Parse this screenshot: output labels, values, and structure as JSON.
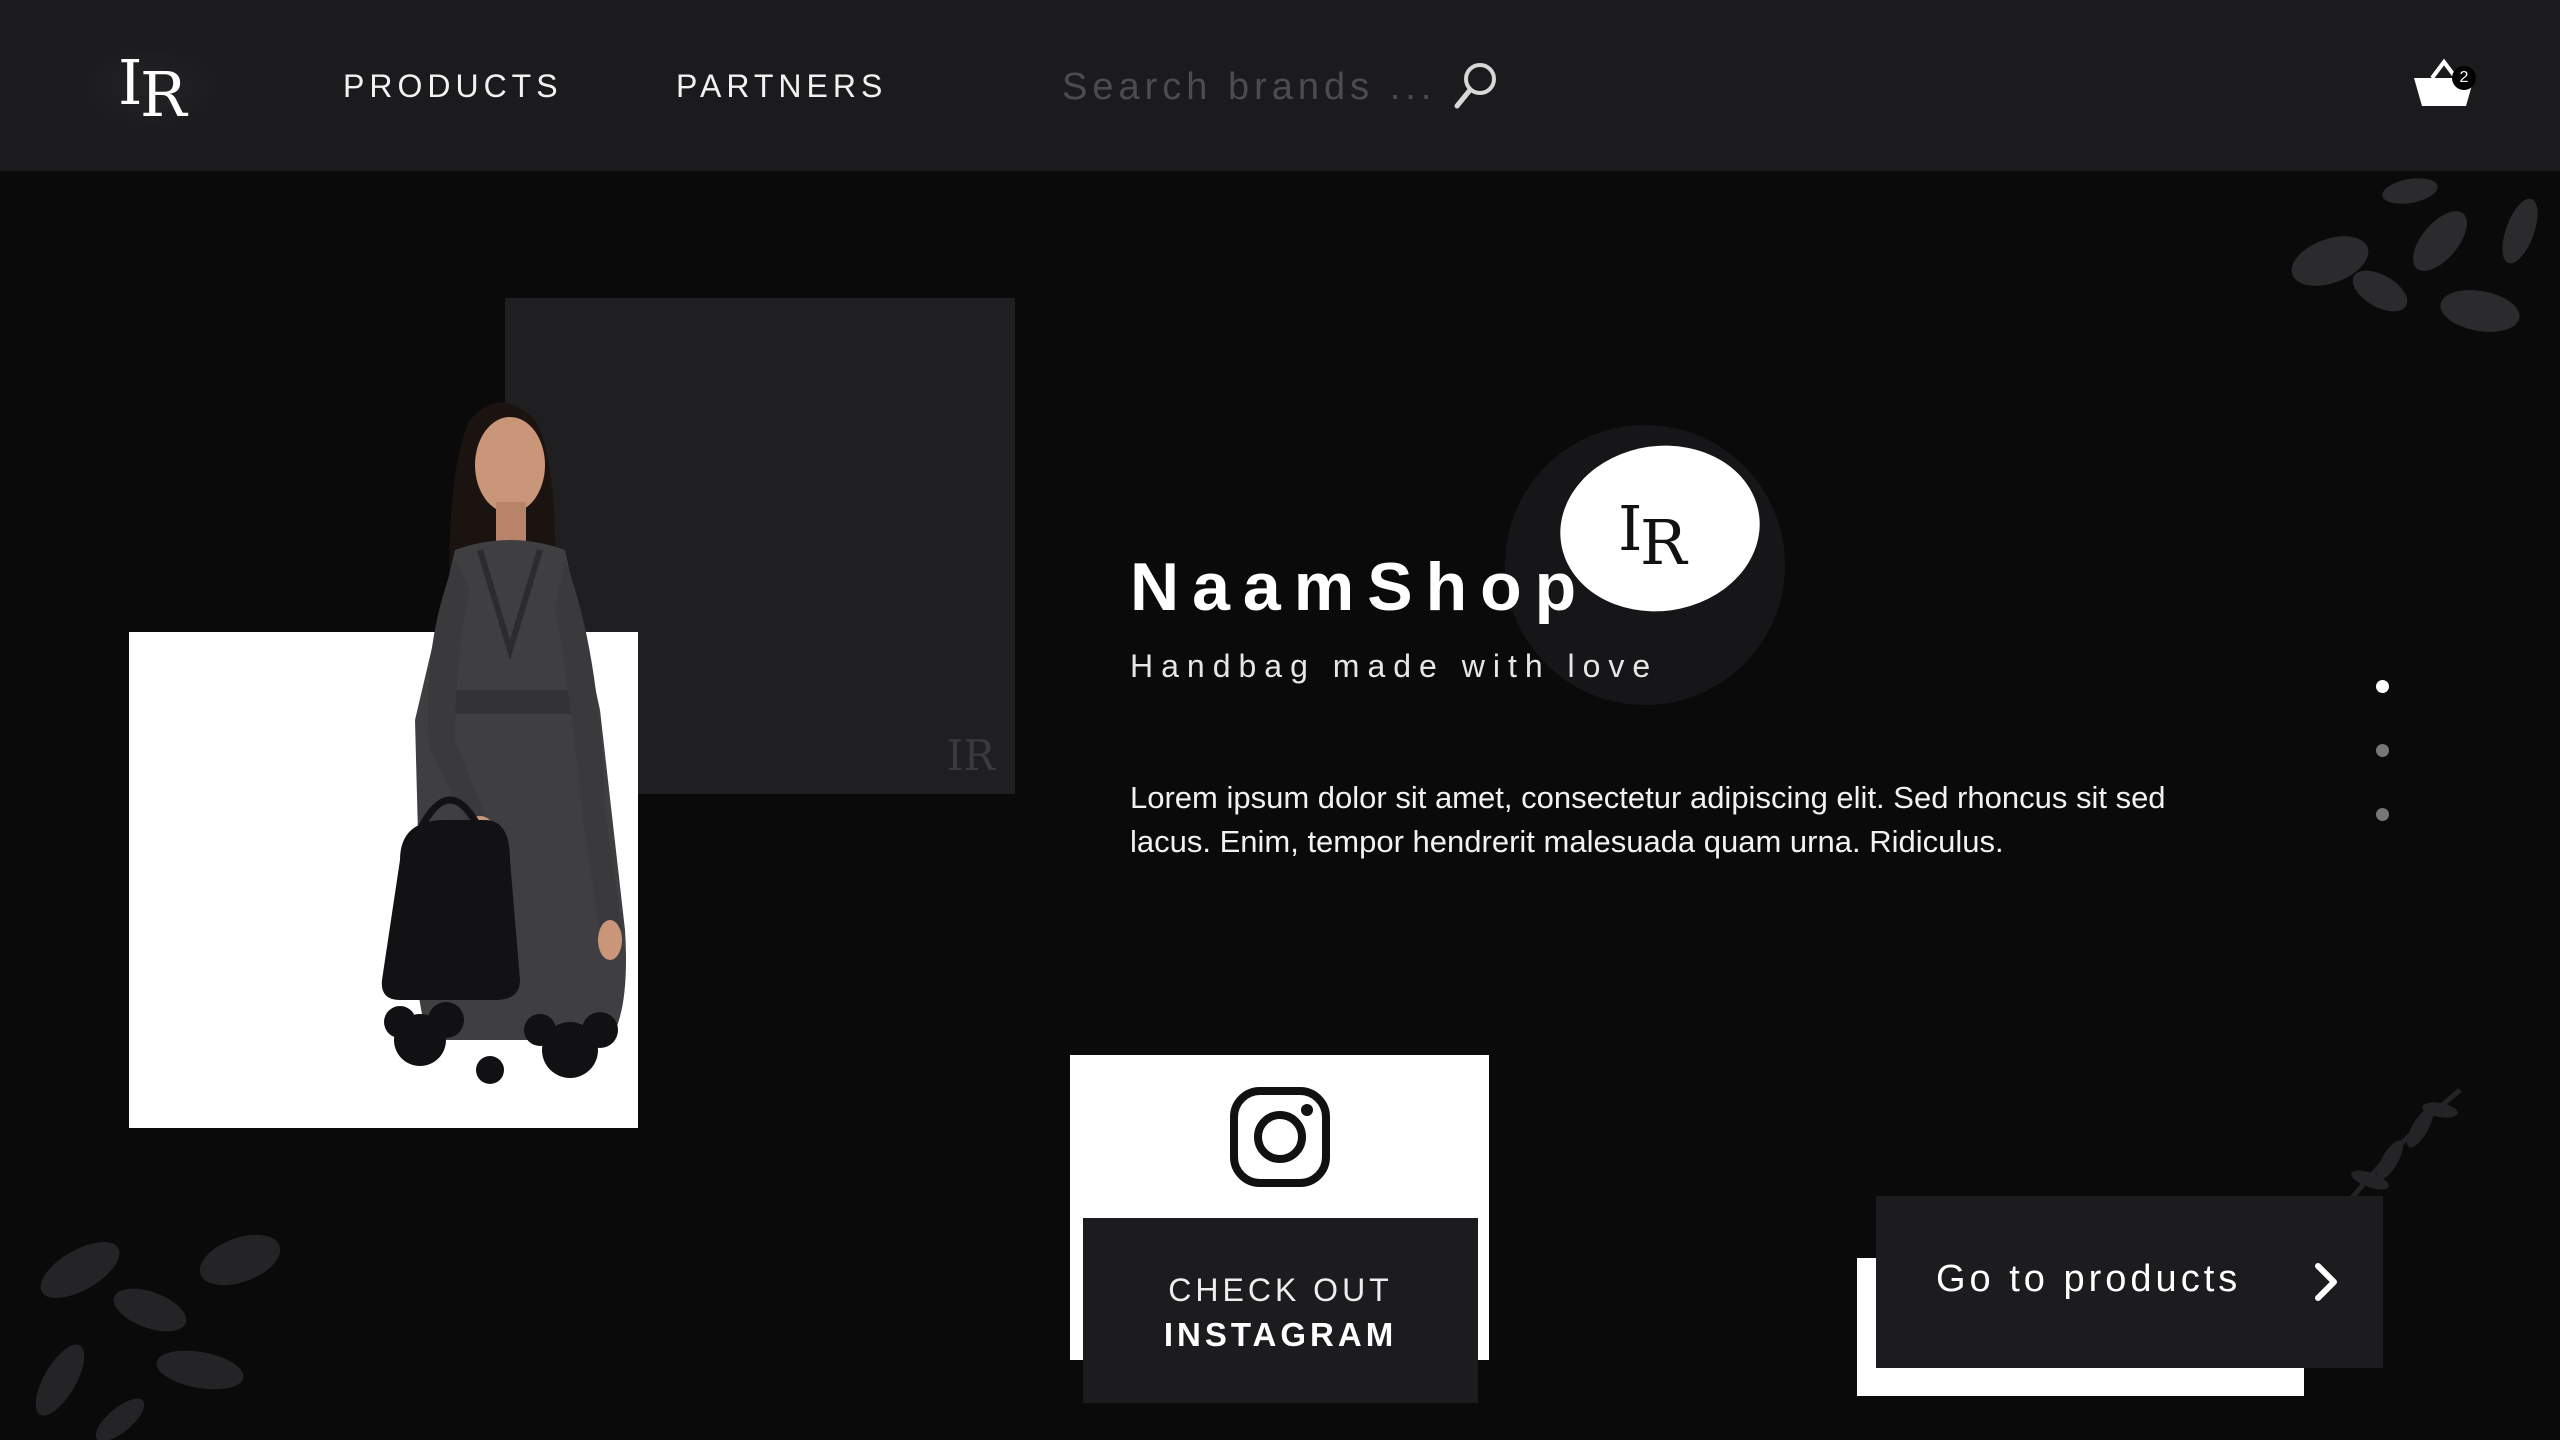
{
  "header": {
    "logo_text": "LR",
    "nav": [
      {
        "label": "PRODUCTS"
      },
      {
        "label": "PARTNERS"
      }
    ],
    "search": {
      "placeholder": "Search brands ..."
    },
    "cart": {
      "count": "2"
    }
  },
  "hero": {
    "brand_name": "NaamShop",
    "tagline": "Handbag made with love",
    "description": "Lorem ipsum dolor sit amet, consectetur adipiscing elit. Sed rhoncus sit sed lacus. Enim, tempor hendrerit malesuada quam urna. Ridiculus.",
    "instagram": {
      "line1": "CHECK OUT",
      "line2": "INSTAGRAM"
    },
    "cta": {
      "label": "Go to products"
    }
  },
  "slider": {
    "count": 3,
    "active_index": 0
  },
  "icons": [
    "logo-icon",
    "search-icon",
    "basket-icon",
    "instagram-icon",
    "chevron-right-icon",
    "leaf-decoration"
  ],
  "colors": {
    "background": "#0a0a0b",
    "header": "#1b1b1d",
    "panel": "#1f1f21",
    "button": "#1c1c1e",
    "accent": "#ffffff",
    "placeholder": "#4c4c50"
  }
}
